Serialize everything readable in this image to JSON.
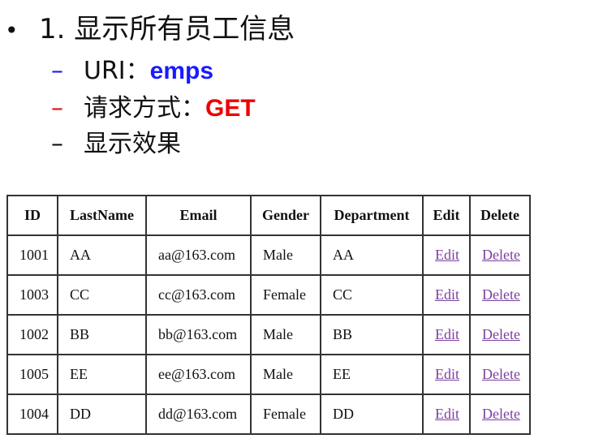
{
  "heading": {
    "bullet": "•",
    "text": "1. 显示所有员工信息"
  },
  "subitems": [
    {
      "dash": "–",
      "label": "URI：",
      "value": "emps"
    },
    {
      "dash": "–",
      "label": "请求方式：",
      "value": "GET"
    },
    {
      "dash": "–",
      "label": "显示效果",
      "value": ""
    }
  ],
  "colors": {
    "blue": "#1a1aff",
    "red": "#ee0000",
    "link": "#7b3fa0"
  },
  "table": {
    "headers": [
      "ID",
      "LastName",
      "Email",
      "Gender",
      "Department",
      "Edit",
      "Delete"
    ],
    "rows": [
      [
        "1001",
        "AA",
        "aa@163.com",
        "Male",
        "AA",
        "Edit",
        "Delete"
      ],
      [
        "1003",
        "CC",
        "cc@163.com",
        "Female",
        "CC",
        "Edit",
        "Delete"
      ],
      [
        "1002",
        "BB",
        "bb@163.com",
        "Male",
        "BB",
        "Edit",
        "Delete"
      ],
      [
        "1005",
        "EE",
        "ee@163.com",
        "Male",
        "EE",
        "Edit",
        "Delete"
      ],
      [
        "1004",
        "DD",
        "dd@163.com",
        "Female",
        "DD",
        "Edit",
        "Delete"
      ]
    ]
  }
}
